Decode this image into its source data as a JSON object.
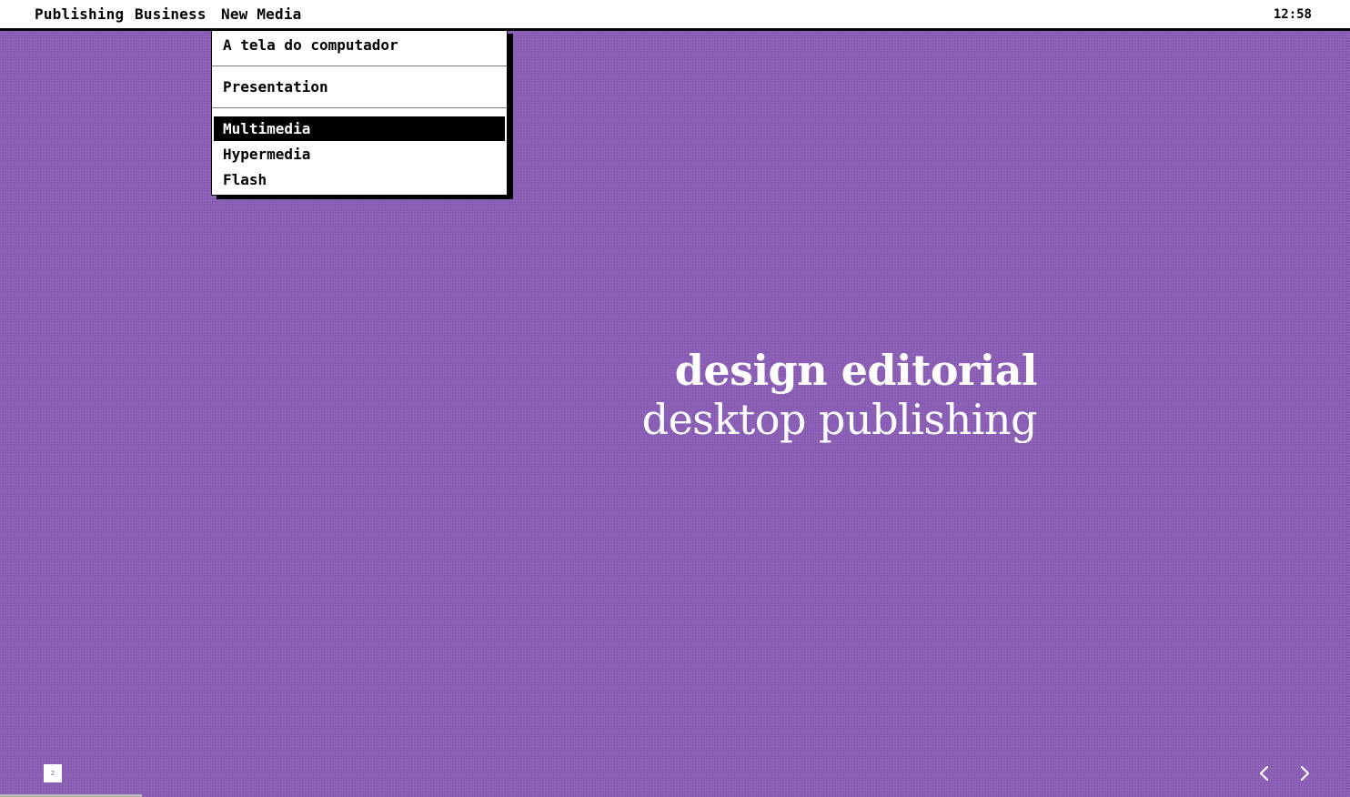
{
  "menubar": {
    "items": [
      "Publishing",
      "Business",
      "New Media"
    ],
    "clock": "12:58"
  },
  "dropdown": {
    "open_menu": "New Media",
    "items": [
      "A tela do computador",
      "Presentation",
      "Multimedia",
      "Hypermedia",
      "Flash"
    ],
    "selected": "Multimedia"
  },
  "headline": {
    "line1": "design editorial",
    "line2": "desktop publishing"
  },
  "slide": {
    "page_number": "2",
    "progress": 0.105
  },
  "icons": {
    "prev": "chevron-left-icon",
    "next": "chevron-right-icon"
  },
  "colors": {
    "background": "#8a5db5",
    "menubar": "#ffffff",
    "selection": "#000000",
    "text_light": "#ffffff"
  }
}
